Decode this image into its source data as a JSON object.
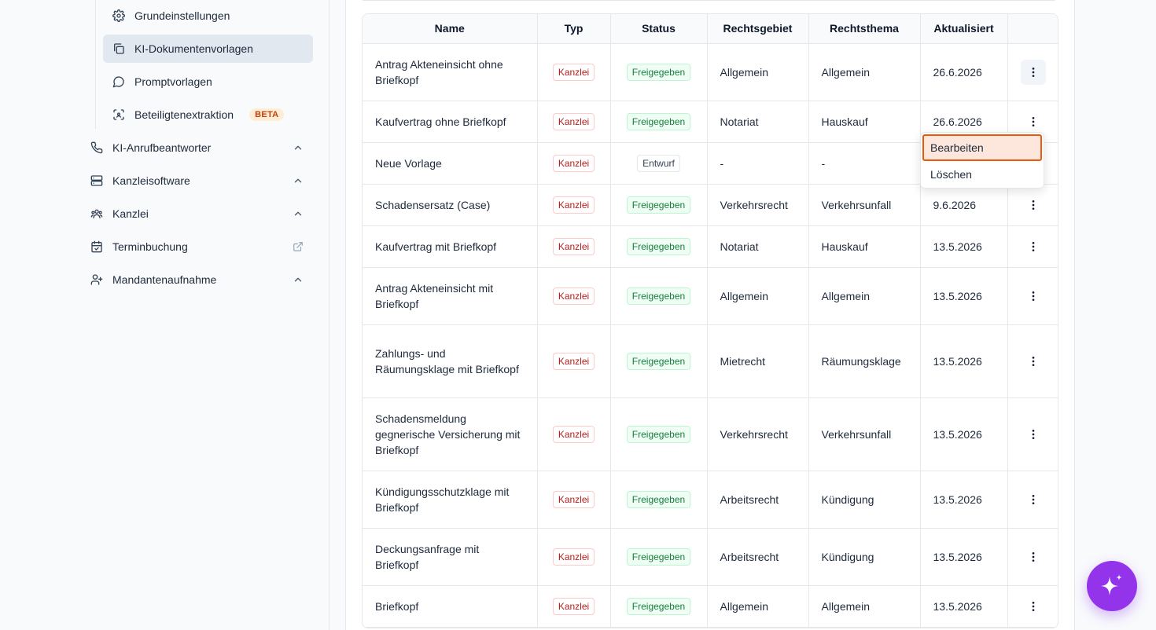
{
  "sidebar": {
    "sub_items": [
      {
        "label": "Grundeinstellungen",
        "icon": "gear-icon"
      },
      {
        "label": "KI-Dokumentenvorlagen",
        "icon": "copy-icon",
        "active": true
      },
      {
        "label": "Promptvorlagen",
        "icon": "chat-bubble-icon"
      },
      {
        "label": "Beteiligtenextraktion",
        "icon": "scan-icon",
        "badge": "BETA"
      }
    ],
    "items": [
      {
        "label": "KI-Anrufbeantworter",
        "icon": "phone-icon"
      },
      {
        "label": "Kanzleisoftware",
        "icon": "server-icon"
      },
      {
        "label": "Kanzlei",
        "icon": "users-icon"
      },
      {
        "label": "Terminbuchung",
        "icon": "calendar-icon"
      },
      {
        "label": "Mandantenaufnahme",
        "icon": "user-plus-icon"
      }
    ]
  },
  "table": {
    "headers": [
      "Name",
      "Typ",
      "Status",
      "Rechtsgebiet",
      "Rechtsthema",
      "Aktualisiert",
      ""
    ],
    "rows": [
      {
        "name": "Antrag Akteneinsicht ohne Briefkopf",
        "typ": "Kanzlei",
        "status": "Freigegeben",
        "gebiet": "Allgemein",
        "thema": "Allgemein",
        "date": "26.6.2026"
      },
      {
        "name": "Kaufvertrag ohne Briefkopf",
        "typ": "Kanzlei",
        "status": "Freigegeben",
        "gebiet": "Notariat",
        "thema": "Hauskauf",
        "date": "26.6.2026"
      },
      {
        "name": "Neue Vorlage",
        "typ": "Kanzlei",
        "status": "Entwurf",
        "gebiet": "-",
        "thema": "-",
        "date": ""
      },
      {
        "name": "Schadensersatz (Case)",
        "typ": "Kanzlei",
        "status": "Freigegeben",
        "gebiet": "Verkehrsrecht",
        "thema": "Verkehrsunfall",
        "date": "9.6.2026"
      },
      {
        "name": "Kaufvertrag mit Briefkopf",
        "typ": "Kanzlei",
        "status": "Freigegeben",
        "gebiet": "Notariat",
        "thema": "Hauskauf",
        "date": "13.5.2026"
      },
      {
        "name": "Antrag Akteneinsicht mit Briefkopf",
        "typ": "Kanzlei",
        "status": "Freigegeben",
        "gebiet": "Allgemein",
        "thema": "Allgemein",
        "date": "13.5.2026"
      },
      {
        "name": "Zahlungs- und Räumungsklage mit Briefkopf",
        "typ": "Kanzlei",
        "status": "Freigegeben",
        "gebiet": "Mietrecht",
        "thema": "Räumungsklage",
        "date": "13.5.2026"
      },
      {
        "name": "Schadensmeldung gegnerische Versicherung mit Briefkopf",
        "typ": "Kanzlei",
        "status": "Freigegeben",
        "gebiet": "Verkehrsrecht",
        "thema": "Verkehrsunfall",
        "date": "13.5.2026"
      },
      {
        "name": "Kündigungsschutzklage mit Briefkopf",
        "typ": "Kanzlei",
        "status": "Freigegeben",
        "gebiet": "Arbeitsrecht",
        "thema": "Kündigung",
        "date": "13.5.2026"
      },
      {
        "name": "Deckungsanfrage mit Briefkopf",
        "typ": "Kanzlei",
        "status": "Freigegeben",
        "gebiet": "Arbeitsrecht",
        "thema": "Kündigung",
        "date": "13.5.2026"
      },
      {
        "name": "Briefkopf",
        "typ": "Kanzlei",
        "status": "Freigegeben",
        "gebiet": "Allgemein",
        "thema": "Allgemein",
        "date": "13.5.2026"
      }
    ]
  },
  "menu": {
    "edit_label": "Bearbeiten",
    "delete_label": "Löschen"
  },
  "fab": {
    "icon": "sparkle-icon"
  },
  "colors": {
    "accent": "#9333ea",
    "highlight": "#ea580c",
    "danger": "#b91c1c",
    "success": "#15803d"
  }
}
